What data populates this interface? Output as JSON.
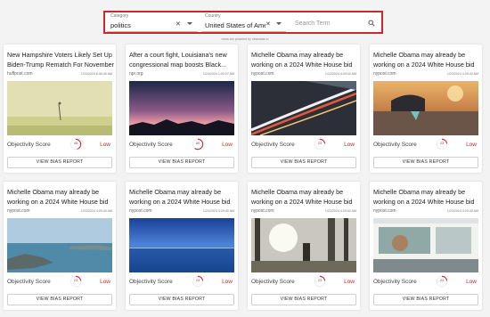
{
  "filters": {
    "category": {
      "label": "Category",
      "value": "politics"
    },
    "country": {
      "label": "Country",
      "value": "United States of Ame..."
    },
    "search": {
      "placeholder": "Search Term"
    },
    "powered_by": "news are powered by newsdata.io"
  },
  "cards": [
    {
      "title": "New Hampshire Voters Likely Set Up Biden-Trump Rematch For November",
      "source": "huffpost.com",
      "date": "1/24/2024 6:46:45 AM",
      "score_label": "Objectivity Score",
      "score": "45",
      "score_pct": 45,
      "bias": "Low",
      "button": "VIEW BIAS REPORT",
      "image": "field-photo"
    },
    {
      "title": "After a court fight, Louisiana's new congressional map boosts Black...",
      "source": "npr.org",
      "date": "1/24/2024 1:00:07 AM",
      "score_label": "Objectivity Score",
      "score": "60",
      "score_pct": 60,
      "bias": "Low",
      "button": "VIEW BIAS REPORT",
      "image": "sunset-mountains-photo"
    },
    {
      "title": "Michelle Obama may already be working on a 2024 White House bid",
      "source": "nypost.com",
      "date": "1/23/2024 4:29:40 AM",
      "score_label": "Objectivity Score",
      "score": "23",
      "score_pct": 23,
      "bias": "Low",
      "button": "VIEW BIAS REPORT",
      "image": "light-trails-photo"
    },
    {
      "title": "Michelle Obama may already be working on a 2024 White House bid",
      "source": "nypost.com",
      "date": "1/23/2024 4:29:40 AM",
      "score_label": "Objectivity Score",
      "score": "23",
      "score_pct": 23,
      "bias": "Low",
      "button": "VIEW BIAS REPORT",
      "image": "beach-sunset-photo"
    },
    {
      "title": "Michelle Obama may already be working on a 2024 White House bid",
      "source": "nypost.com",
      "date": "1/23/2024 4:29:40 AM",
      "score_label": "Objectivity Score",
      "score": "23",
      "score_pct": 23,
      "bias": "Low",
      "button": "VIEW BIAS REPORT",
      "image": "coast-rocks-photo"
    },
    {
      "title": "Michelle Obama may already be working on a 2024 White House bid",
      "source": "nypost.com",
      "date": "1/23/2024 4:29:40 AM",
      "score_label": "Objectivity Score",
      "score": "23",
      "score_pct": 23,
      "bias": "Low",
      "button": "VIEW BIAS REPORT",
      "image": "blue-sea-photo"
    },
    {
      "title": "Michelle Obama may already be working on a 2024 White House bid",
      "source": "nypost.com",
      "date": "1/23/2024 4:29:40 AM",
      "score_label": "Objectivity Score",
      "score": "23",
      "score_pct": 23,
      "bias": "Low",
      "button": "VIEW BIAS REPORT",
      "image": "forest-sunlight-photo"
    },
    {
      "title": "Michelle Obama may already be working on a 2024 White House bid",
      "source": "nypost.com",
      "date": "1/23/2024 4:29:40 AM",
      "score_label": "Objectivity Score",
      "score": "23",
      "score_pct": 23,
      "bias": "Low",
      "button": "VIEW BIAS REPORT",
      "image": "van-window-photo"
    }
  ],
  "colors": {
    "accent": "#d0262b",
    "background": "#f3f3f3"
  }
}
